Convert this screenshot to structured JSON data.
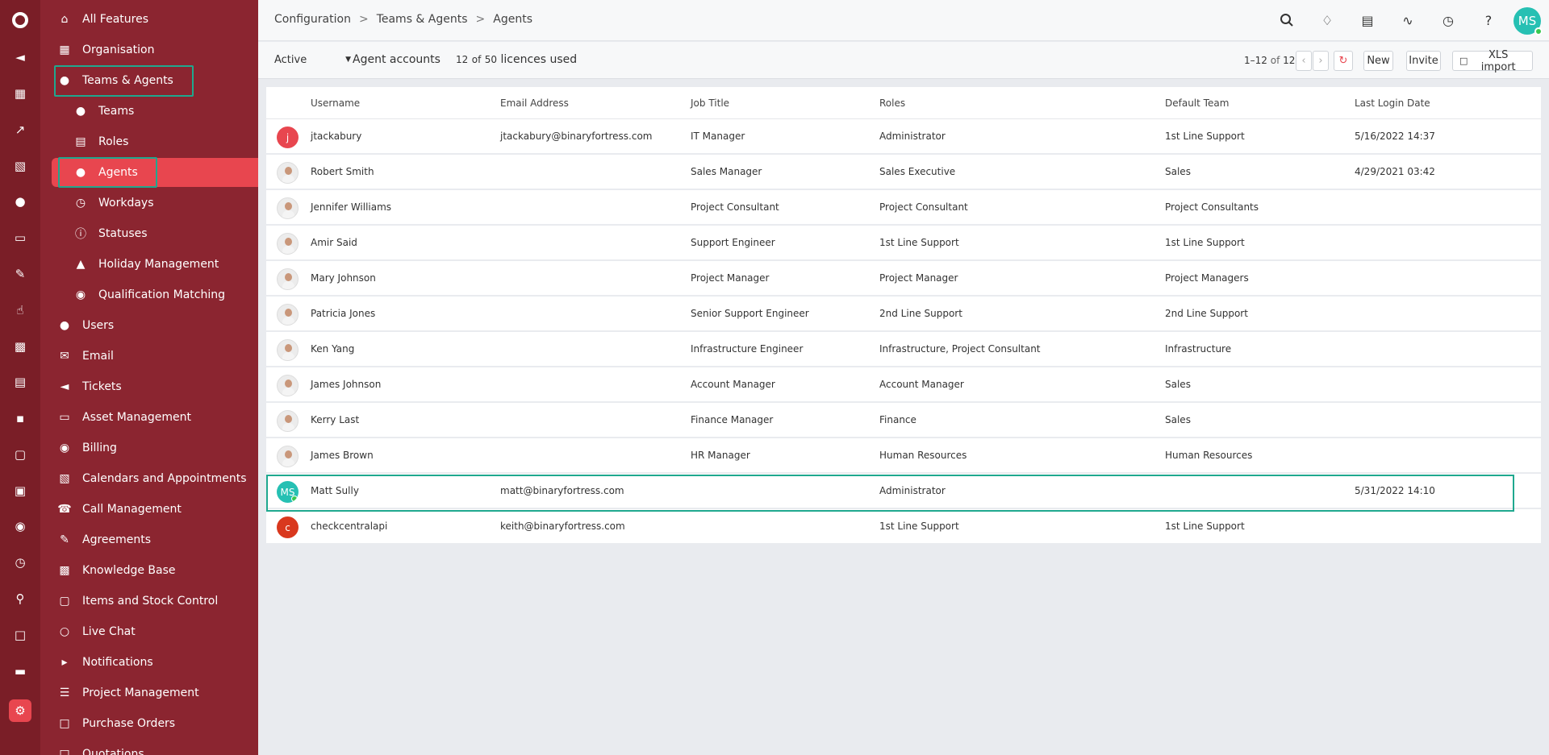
{
  "rail": {
    "icons": [
      "circle-logo-icon",
      "ticket-icon",
      "org-chart-icon",
      "chart-icon",
      "calendar-icon",
      "user-icon",
      "laptop-icon",
      "edit-icon",
      "thumbs-up-icon",
      "cubes-icon",
      "book-icon",
      "truck-icon",
      "box-icon",
      "document-gear-icon",
      "money-bag-icon",
      "clock-icon",
      "search-icon",
      "document-icon",
      "monitor-icon",
      "settings-cog-icon"
    ]
  },
  "nav": {
    "items": [
      {
        "label": "All Features",
        "icon": "home-icon"
      },
      {
        "label": "Organisation",
        "icon": "building-icon"
      },
      {
        "label": "Teams & Agents",
        "icon": "user-icon"
      },
      {
        "label": "Teams",
        "icon": "users-icon"
      },
      {
        "label": "Roles",
        "icon": "list-icon"
      },
      {
        "label": "Agents",
        "icon": "user-icon"
      },
      {
        "label": "Workdays",
        "icon": "clock-icon"
      },
      {
        "label": "Statuses",
        "icon": "info-icon"
      },
      {
        "label": "Holiday Management",
        "icon": "walking-icon"
      },
      {
        "label": "Qualification Matching",
        "icon": "award-icon"
      },
      {
        "label": "Users",
        "icon": "user-icon"
      },
      {
        "label": "Email",
        "icon": "email-icon"
      },
      {
        "label": "Tickets",
        "icon": "ticket-icon"
      },
      {
        "label": "Asset Management",
        "icon": "laptop-icon"
      },
      {
        "label": "Billing",
        "icon": "money-bag-icon"
      },
      {
        "label": "Calendars and Appointments",
        "icon": "calendar-icon"
      },
      {
        "label": "Call Management",
        "icon": "phone-icon"
      },
      {
        "label": "Agreements",
        "icon": "edit-icon"
      },
      {
        "label": "Knowledge Base",
        "icon": "cubes-icon"
      },
      {
        "label": "Items and Stock Control",
        "icon": "box-icon"
      },
      {
        "label": "Live Chat",
        "icon": "chat-icon"
      },
      {
        "label": "Notifications",
        "icon": "megaphone-icon"
      },
      {
        "label": "Project Management",
        "icon": "gantt-icon"
      },
      {
        "label": "Purchase Orders",
        "icon": "po-icon"
      },
      {
        "label": "Quotations",
        "icon": "quote-icon"
      }
    ]
  },
  "breadcrumb": {
    "items": [
      "Configuration",
      "Teams & Agents",
      "Agents"
    ],
    "sep": ">"
  },
  "header_icons": [
    "search-icon",
    "bell-icon",
    "clipboard-icon",
    "rss-icon",
    "clock-icon",
    "help-icon"
  ],
  "user": {
    "initials": "MS"
  },
  "toolbar": {
    "status": "Active",
    "accounts_label": "Agent accounts",
    "licences_used": "12",
    "licences_of": "of",
    "licences_total": "50",
    "licences_suffix": "licences used",
    "pager_range": "1–12",
    "pager_of": "of",
    "pager_total": "12",
    "new_label": "New",
    "invite_label": "Invite",
    "xls_label": "XLS import"
  },
  "table": {
    "columns": [
      "Username",
      "Email Address",
      "Job Title",
      "Roles",
      "Default Team",
      "Last Login Date"
    ],
    "rows": [
      {
        "avatar": "j",
        "avatar_color": "#e8464f",
        "username": "jtackabury",
        "email": "jtackabury@binaryfortress.com",
        "job": "IT Manager",
        "roles": "Administrator",
        "team": "1st Line Support",
        "login": "5/16/2022 14:37"
      },
      {
        "avatar": "",
        "avatar_color": "",
        "username": "Robert Smith",
        "email": "",
        "job": "Sales Manager",
        "roles": "Sales Executive",
        "team": "Sales",
        "login": "4/29/2021 03:42"
      },
      {
        "avatar": "",
        "avatar_color": "",
        "username": "Jennifer Williams",
        "email": "",
        "job": "Project Consultant",
        "roles": "Project Consultant",
        "team": "Project Consultants",
        "login": ""
      },
      {
        "avatar": "",
        "avatar_color": "",
        "username": "Amir Said",
        "email": "",
        "job": "Support Engineer",
        "roles": "1st Line Support",
        "team": "1st Line Support",
        "login": ""
      },
      {
        "avatar": "",
        "avatar_color": "",
        "username": "Mary Johnson",
        "email": "",
        "job": "Project Manager",
        "roles": "Project Manager",
        "team": "Project Managers",
        "login": ""
      },
      {
        "avatar": "",
        "avatar_color": "",
        "username": "Patricia Jones",
        "email": "",
        "job": "Senior Support Engineer",
        "roles": "2nd Line Support",
        "team": "2nd Line Support",
        "login": ""
      },
      {
        "avatar": "",
        "avatar_color": "",
        "username": "Ken Yang",
        "email": "",
        "job": "Infrastructure Engineer",
        "roles": "Infrastructure, Project Consultant",
        "team": "Infrastructure",
        "login": ""
      },
      {
        "avatar": "",
        "avatar_color": "",
        "username": "James Johnson",
        "email": "",
        "job": "Account Manager",
        "roles": "Account Manager",
        "team": "Sales",
        "login": ""
      },
      {
        "avatar": "",
        "avatar_color": "",
        "username": "Kerry Last",
        "email": "",
        "job": "Finance Manager",
        "roles": "Finance",
        "team": "Sales",
        "login": ""
      },
      {
        "avatar": "",
        "avatar_color": "",
        "username": "James Brown",
        "email": "",
        "job": "HR Manager",
        "roles": "Human Resources",
        "team": "Human Resources",
        "login": ""
      },
      {
        "avatar": "MS",
        "avatar_color": "#26c0b3",
        "username": "Matt Sully",
        "email": "matt@binaryfortress.com",
        "job": "",
        "roles": "Administrator",
        "team": "",
        "login": "5/31/2022 14:10"
      },
      {
        "avatar": "c",
        "avatar_color": "#d9381e",
        "username": "checkcentralapi",
        "email": "keith@binaryfortress.com",
        "job": "",
        "roles": "1st Line Support",
        "team": "1st Line Support",
        "login": ""
      }
    ]
  }
}
